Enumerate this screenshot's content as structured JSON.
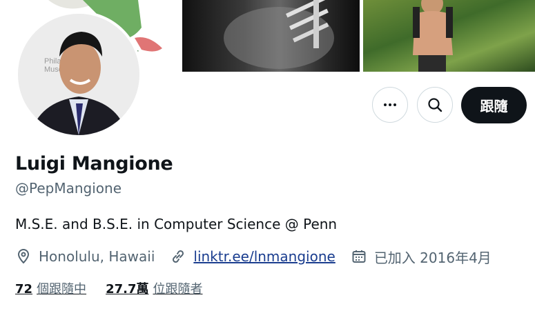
{
  "profile": {
    "name": "Luigi Mangione",
    "handle": "@PepMangione",
    "bio": "M.S.E. and B.S.E. in Computer Science @ Penn",
    "location": "Honolulu, Hawaii",
    "link": "linktr.ee/lnmangione",
    "joined": "已加入 2016年4月"
  },
  "actions": {
    "more_icon": "more-icon",
    "search_icon": "search-icon",
    "follow_label": "跟隨"
  },
  "stats": {
    "following_count": "72",
    "following_label": "個跟隨中",
    "followers_count": "27.7萬",
    "followers_label": "位跟隨者"
  },
  "colors": {
    "text": "#0f1419",
    "secondary": "#536471",
    "link": "#1a3d8f",
    "button_dark": "#0f1419",
    "border": "#cfd9de"
  }
}
